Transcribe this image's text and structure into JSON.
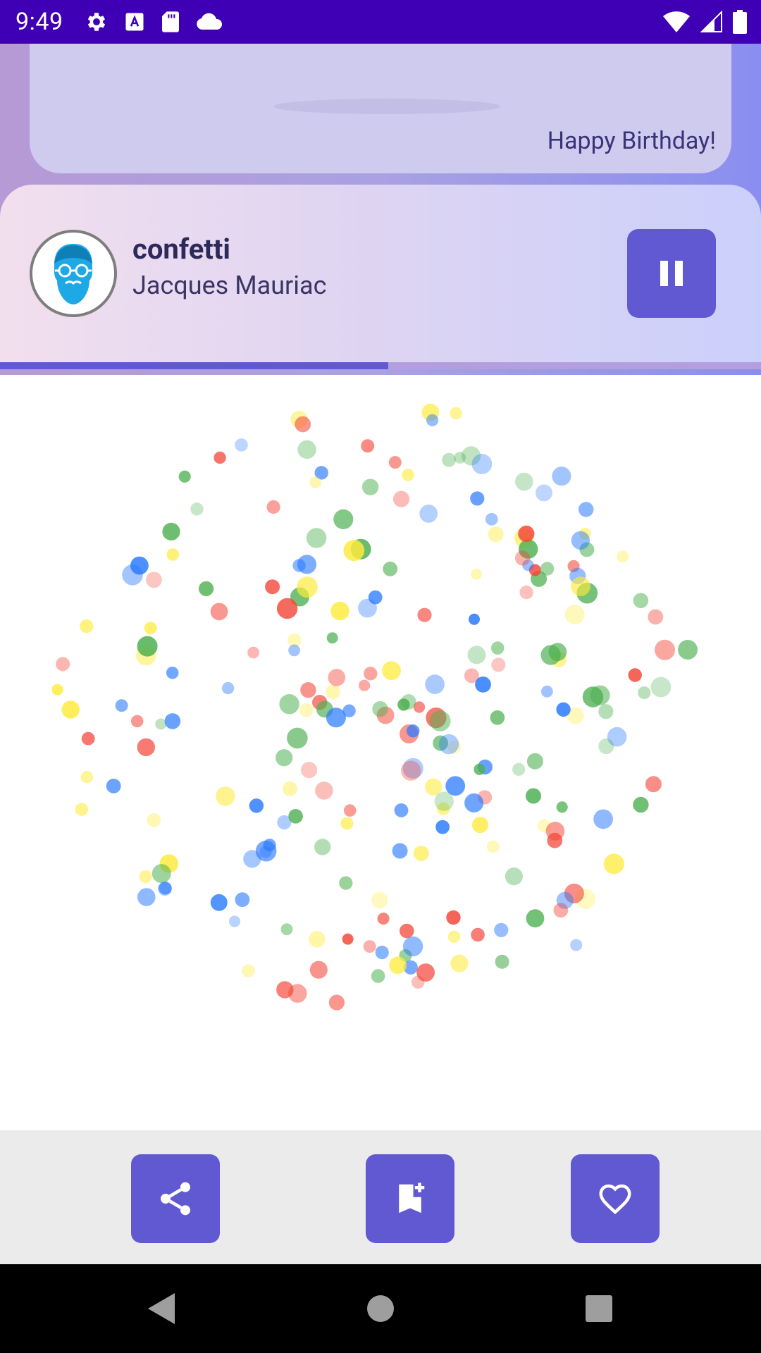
{
  "status_bar": {
    "time": "9:49",
    "left_icons": [
      "gear-icon",
      "text-a-icon",
      "sd-card-icon",
      "cloud-icon"
    ],
    "right_icons": [
      "wifi-icon",
      "signal-icon",
      "battery-icon"
    ]
  },
  "greeting": {
    "text": "Happy Birthday!"
  },
  "player": {
    "title": "confetti",
    "artist": "Jacques Mauriac",
    "avatar_icon": "bearded-man-avatar-icon",
    "state_icon": "pause-icon",
    "progress": 0.51
  },
  "actions": [
    {
      "name": "share",
      "icon": "share-icon"
    },
    {
      "name": "bookmark-add",
      "icon": "bookmark-add-icon"
    },
    {
      "name": "favorite",
      "icon": "heart-outline-icon"
    }
  ],
  "navigation": [
    "back",
    "home",
    "recents"
  ],
  "colors": {
    "status_bar": "#3f00b5",
    "accent": "#6159d1",
    "confetti": [
      "#f44336",
      "#ffeb3b",
      "#4caf50",
      "#2979ff"
    ]
  }
}
